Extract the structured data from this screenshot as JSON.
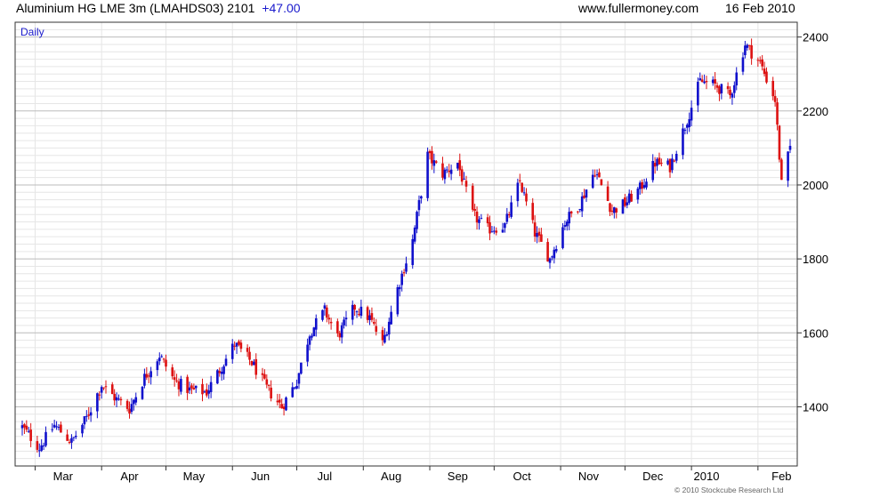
{
  "header": {
    "instrument": "Aluminium HG LME 3m (LMAHDS03)",
    "last": "2101",
    "change": "+47.00",
    "site": "www.fullermoney.com",
    "date": "16 Feb 2010"
  },
  "copyright": "© 2010 Stockcube Research Ltd",
  "colors": {
    "up": "#1010cc",
    "down": "#dd1111",
    "grid_major": "#bbbbbb",
    "grid_minor": "#e6e6e6"
  },
  "chart_data": {
    "type": "candlestick",
    "period_label": "Daily",
    "x_ticks": [
      "Mar",
      "Apr",
      "May",
      "Jun",
      "Jul",
      "Aug",
      "Sep",
      "Oct",
      "Nov",
      "Dec",
      "2010",
      "Feb"
    ],
    "y_ticks": [
      1400,
      1600,
      1800,
      2000,
      2200,
      2400
    ],
    "ylim": [
      1240,
      2440
    ],
    "grid": true,
    "start_date": "2009-02-23",
    "end_date": "2010-02-16",
    "close_path": [
      [
        "2009-02-23",
        1345
      ],
      [
        "2009-03-03",
        1290
      ],
      [
        "2009-03-10",
        1350
      ],
      [
        "2009-03-18",
        1305
      ],
      [
        "2009-03-25",
        1370
      ],
      [
        "2009-04-01",
        1460
      ],
      [
        "2009-04-08",
        1420
      ],
      [
        "2009-04-14",
        1395
      ],
      [
        "2009-04-21",
        1480
      ],
      [
        "2009-04-28",
        1540
      ],
      [
        "2009-05-05",
        1470
      ],
      [
        "2009-05-12",
        1445
      ],
      [
        "2009-05-20",
        1440
      ],
      [
        "2009-05-26",
        1500
      ],
      [
        "2009-06-02",
        1570
      ],
      [
        "2009-06-10",
        1520
      ],
      [
        "2009-06-17",
        1450
      ],
      [
        "2009-06-24",
        1400
      ],
      [
        "2009-07-01",
        1470
      ],
      [
        "2009-07-07",
        1600
      ],
      [
        "2009-07-14",
        1660
      ],
      [
        "2009-07-20",
        1590
      ],
      [
        "2009-07-28",
        1670
      ],
      [
        "2009-08-04",
        1640
      ],
      [
        "2009-08-10",
        1570
      ],
      [
        "2009-08-17",
        1720
      ],
      [
        "2009-08-24",
        1850
      ],
      [
        "2009-08-31",
        2080
      ],
      [
        "2009-09-07",
        2030
      ],
      [
        "2009-09-14",
        2060
      ],
      [
        "2009-09-21",
        1920
      ],
      [
        "2009-09-28",
        1880
      ],
      [
        "2009-10-06",
        1890
      ],
      [
        "2009-10-13",
        2010
      ],
      [
        "2009-10-20",
        1870
      ],
      [
        "2009-10-27",
        1800
      ],
      [
        "2009-11-03",
        1900
      ],
      [
        "2009-11-10",
        1950
      ],
      [
        "2009-11-17",
        2040
      ],
      [
        "2009-11-25",
        1930
      ],
      [
        "2009-12-01",
        1950
      ],
      [
        "2009-12-08",
        1990
      ],
      [
        "2009-12-15",
        2060
      ],
      [
        "2009-12-22",
        2050
      ],
      [
        "2009-12-29",
        2160
      ],
      [
        "2010-01-05",
        2280
      ],
      [
        "2010-01-12",
        2270
      ],
      [
        "2010-01-19",
        2240
      ],
      [
        "2010-01-26",
        2380
      ],
      [
        "2010-02-02",
        2330
      ],
      [
        "2010-02-09",
        2230
      ],
      [
        "2010-02-12",
        2000
      ],
      [
        "2010-02-16",
        2101
      ]
    ]
  }
}
